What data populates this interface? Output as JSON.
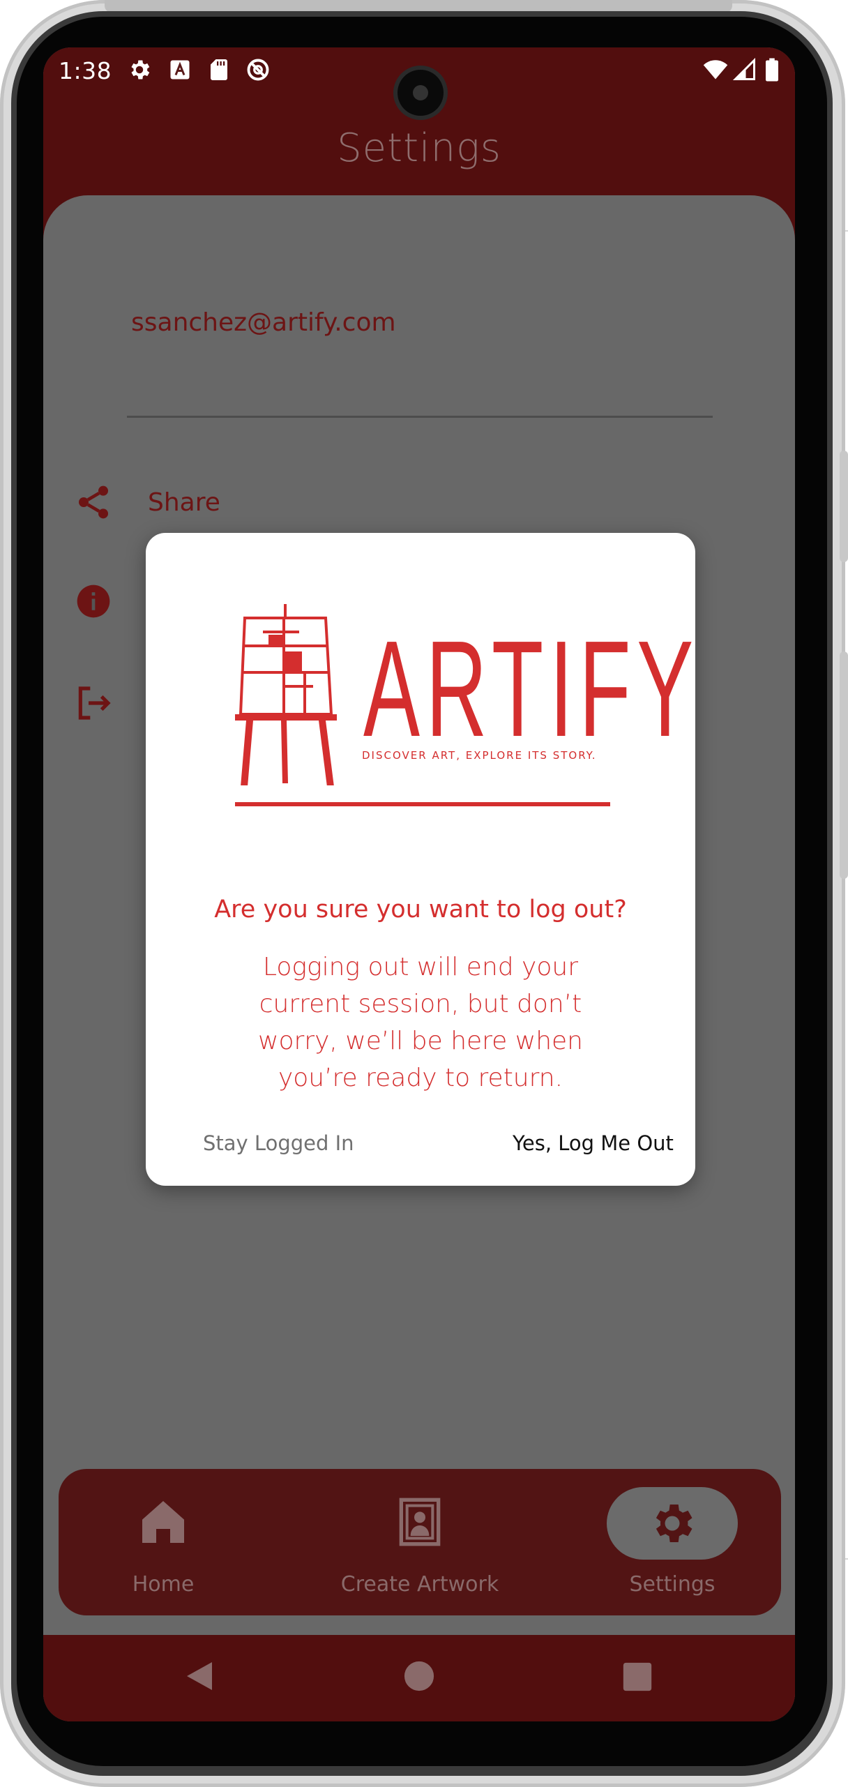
{
  "status_bar": {
    "time": "1:38",
    "left_icons": [
      "settings-gear-icon",
      "text-a-icon",
      "sd-card-icon",
      "do-not-disturb-icon"
    ],
    "right_icons": [
      "wifi-icon",
      "signal-icon",
      "battery-icon"
    ]
  },
  "app": {
    "title": "Settings",
    "account_email": "ssanchez@artify.com",
    "menu_items": [
      {
        "label": "Share",
        "icon": "share-icon"
      },
      {
        "label": "",
        "icon": "info-icon"
      },
      {
        "label": "",
        "icon": "logout-icon"
      }
    ]
  },
  "bottom_nav": {
    "items": [
      {
        "label": "Home",
        "icon": "home-icon",
        "active": false
      },
      {
        "label": "Create Artwork",
        "icon": "framed-portrait-icon",
        "active": false
      },
      {
        "label": "Settings",
        "icon": "settings-gear-icon",
        "active": true
      }
    ]
  },
  "dialog": {
    "logo_word": "ARTIFY",
    "logo_tagline": "DISCOVER ART, EXPLORE ITS STORY.",
    "title": "Are you sure you want to log out?",
    "body": "Logging out will end your current session, but don’t worry, we’ll be here when you’re ready to return.",
    "cancel_label": "Stay Logged In",
    "confirm_label": "Yes, Log Me Out"
  },
  "colors": {
    "brand_red": "#d42e2e",
    "header_red_dimmed": "#521414",
    "scrim": "rgba(0,0,0,0.5)"
  }
}
